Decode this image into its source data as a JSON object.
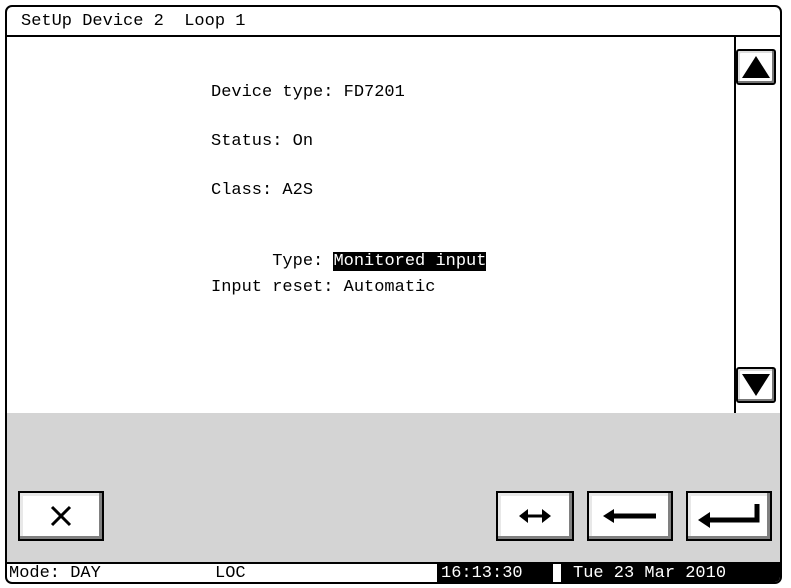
{
  "title": "SetUp Device 2  Loop 1",
  "fields": {
    "device_type": "Device type: FD7201",
    "status": "Status: On",
    "class": "Class: A2S",
    "type_label": "Type: ",
    "type_value": "Monitored input",
    "input_reset": "Input reset: Automatic"
  },
  "icons": {
    "scroll_up": "triangle-up-icon",
    "scroll_down": "triangle-down-icon",
    "close": "x-icon",
    "swap": "left-right-arrow-icon",
    "back": "left-arrow-icon",
    "enter": "enter-arrow-icon"
  },
  "statusbar": {
    "mode": "Mode: DAY",
    "loc": "LOC",
    "time": "16:13:30",
    "date": "Tue 23 Mar 2010"
  }
}
